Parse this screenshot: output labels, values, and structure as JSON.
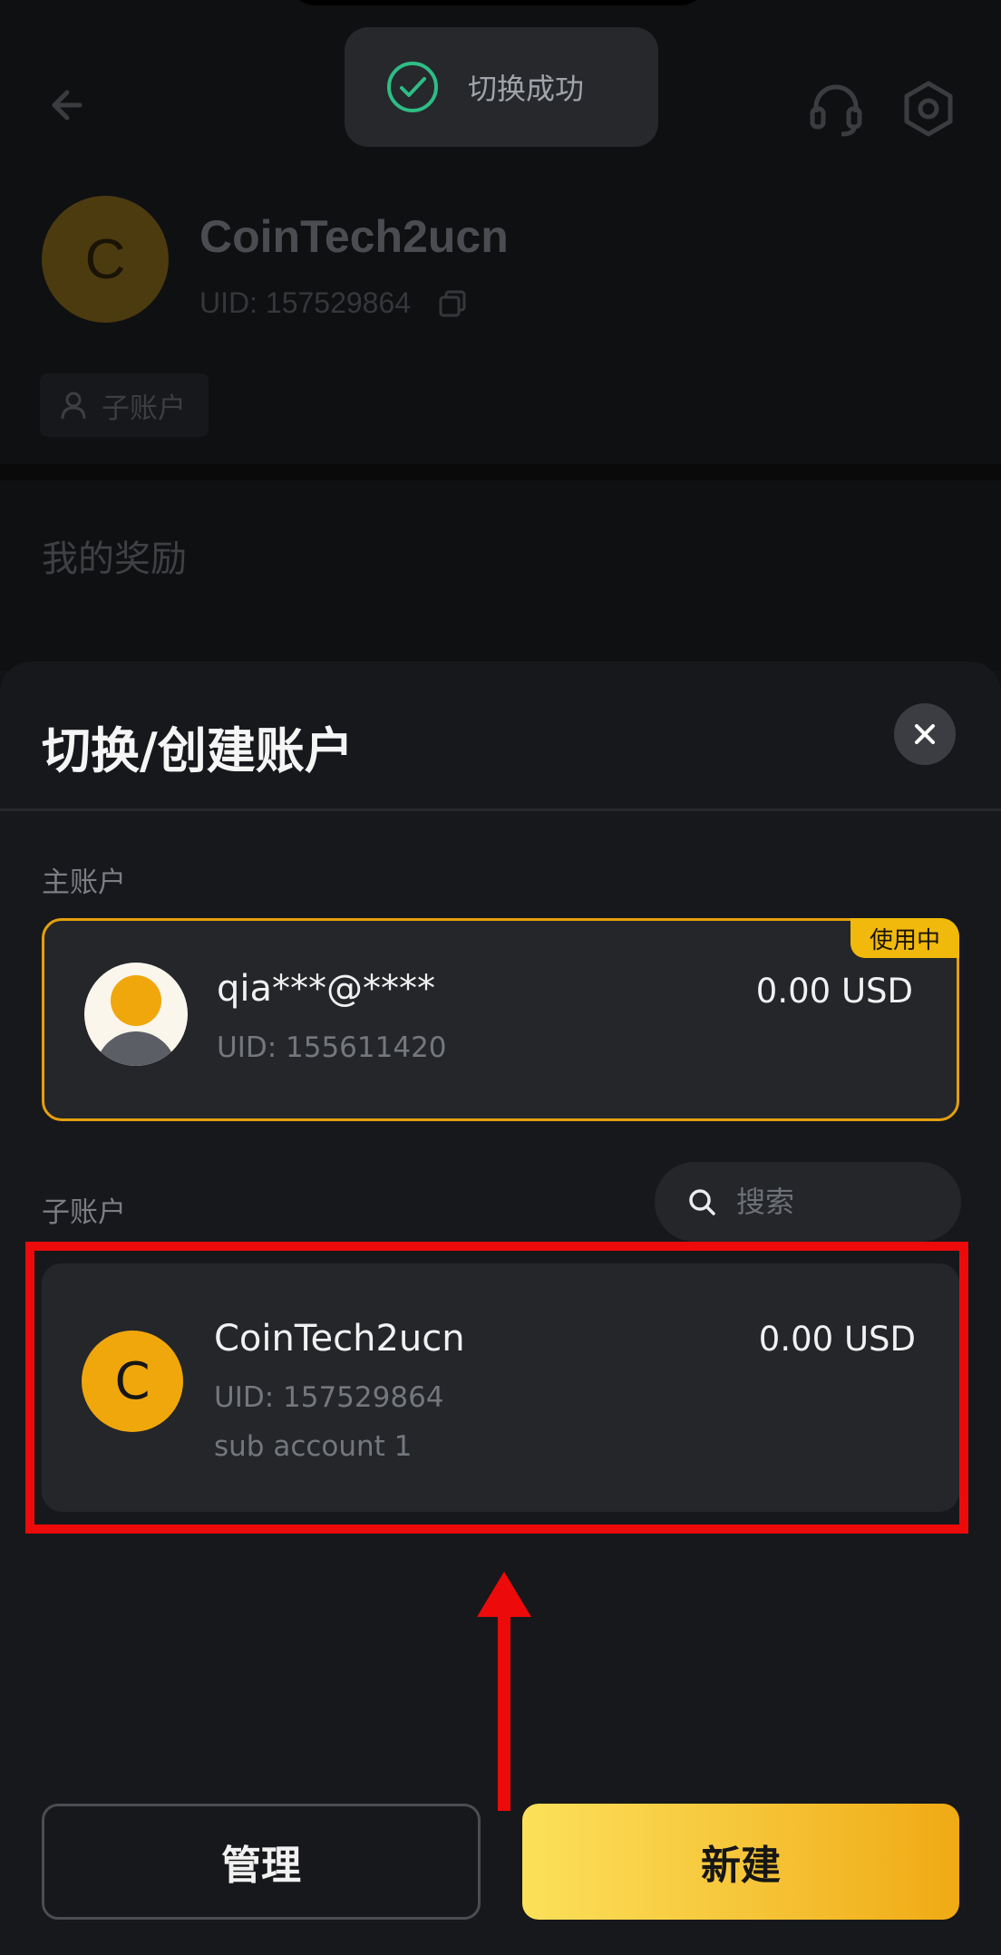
{
  "toast": {
    "text": "切换成功"
  },
  "background": {
    "avatar_letter": "C",
    "account_name": "CoinTech2ucn",
    "uid": "UID: 157529864",
    "sub_account_chip": "子账户",
    "rewards_title": "我的奖励"
  },
  "sheet": {
    "title": "切换/创建账户",
    "main_section_label": "主账户",
    "main_account": {
      "name": "qia***@****",
      "uid": "UID: 155611420",
      "balance": "0.00 USD",
      "badge": "使用中"
    },
    "sub_section_label": "子账户",
    "search": {
      "placeholder": "搜索"
    },
    "sub_accounts": [
      {
        "avatar_letter": "C",
        "name": "CoinTech2ucn",
        "uid": "UID: 157529864",
        "note": "sub account 1",
        "balance": "0.00 USD"
      }
    ],
    "manage_label": "管理",
    "new_label": "新建"
  },
  "colors": {
    "accent": "#f0b90b",
    "sheet_bg": "#17181b",
    "card_bg": "#24262a",
    "annotation_red": "#ec0a0a",
    "toast_check": "#2ebd85"
  },
  "icons": {
    "back": "back-arrow-icon",
    "support": "headset-icon",
    "settings": "settings-hex-icon",
    "copy": "copy-icon",
    "person": "person-icon",
    "search": "search-icon",
    "close": "close-icon",
    "success": "check-circle-icon"
  }
}
